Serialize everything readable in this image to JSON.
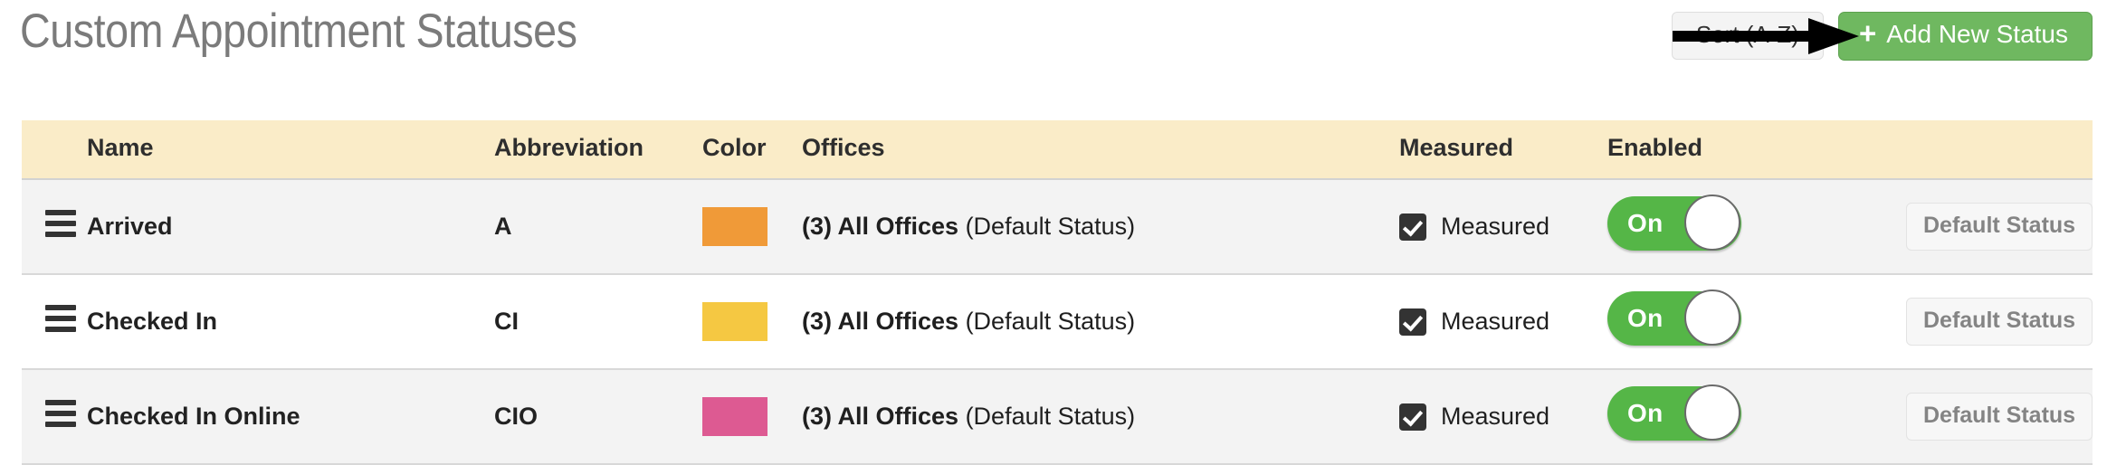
{
  "header": {
    "title": "Custom Appointment Statuses",
    "sort_button_label": "Sort (A-Z)",
    "add_button_label": "Add New Status",
    "add_button_plus": "+",
    "add_button_color": "#6fb860"
  },
  "annotation": {
    "type": "arrow",
    "points_to": "add-status-button",
    "color": "#000000"
  },
  "table": {
    "columns": [
      {
        "key": "handle",
        "label": ""
      },
      {
        "key": "name",
        "label": "Name"
      },
      {
        "key": "abbrev",
        "label": "Abbreviation"
      },
      {
        "key": "color",
        "label": "Color"
      },
      {
        "key": "offices",
        "label": "Offices"
      },
      {
        "key": "measured",
        "label": "Measured"
      },
      {
        "key": "enabled",
        "label": "Enabled"
      },
      {
        "key": "action",
        "label": ""
      }
    ],
    "header_background": "#faecc8",
    "rows": [
      {
        "name": "Arrived",
        "abbreviation": "A",
        "color": "#f09a38",
        "offices_primary": "(3) All Offices",
        "offices_note": "(Default Status)",
        "measured_checked": true,
        "measured_label": "Measured",
        "enabled_state": "On",
        "action_label": "Default Status",
        "row_shaded": true
      },
      {
        "name": "Checked In",
        "abbreviation": "CI",
        "color": "#f5c842",
        "offices_primary": "(3) All Offices",
        "offices_note": "(Default Status)",
        "measured_checked": true,
        "measured_label": "Measured",
        "enabled_state": "On",
        "action_label": "Default Status",
        "row_shaded": false
      },
      {
        "name": "Checked In Online",
        "abbreviation": "CIO",
        "color": "#dd5a92",
        "offices_primary": "(3) All Offices",
        "offices_note": "(Default Status)",
        "measured_checked": true,
        "measured_label": "Measured",
        "enabled_state": "On",
        "action_label": "Default Status",
        "row_shaded": true
      }
    ]
  }
}
